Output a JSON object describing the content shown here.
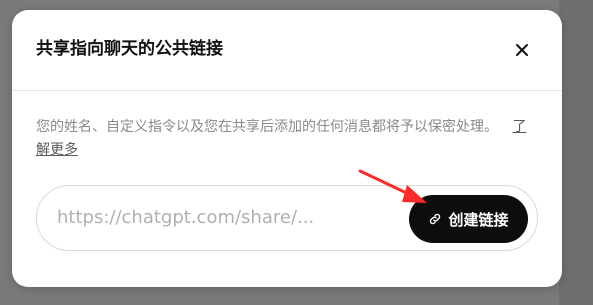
{
  "dialog": {
    "title": "共享指向聊天的公共链接",
    "close_icon": "close-icon",
    "description": "您的姓名、自定义指令以及您在共享后添加的任何消息都将予以保密处理。",
    "learn_more": "了解更多",
    "share_url": "https://chatgpt.com/share/...",
    "create_button_label": "创建链接",
    "link_icon": "link-icon"
  },
  "colors": {
    "overlay": "#7a7a7a",
    "button_bg": "#0d0d0d",
    "annotation_arrow": "#ff2a2a"
  }
}
